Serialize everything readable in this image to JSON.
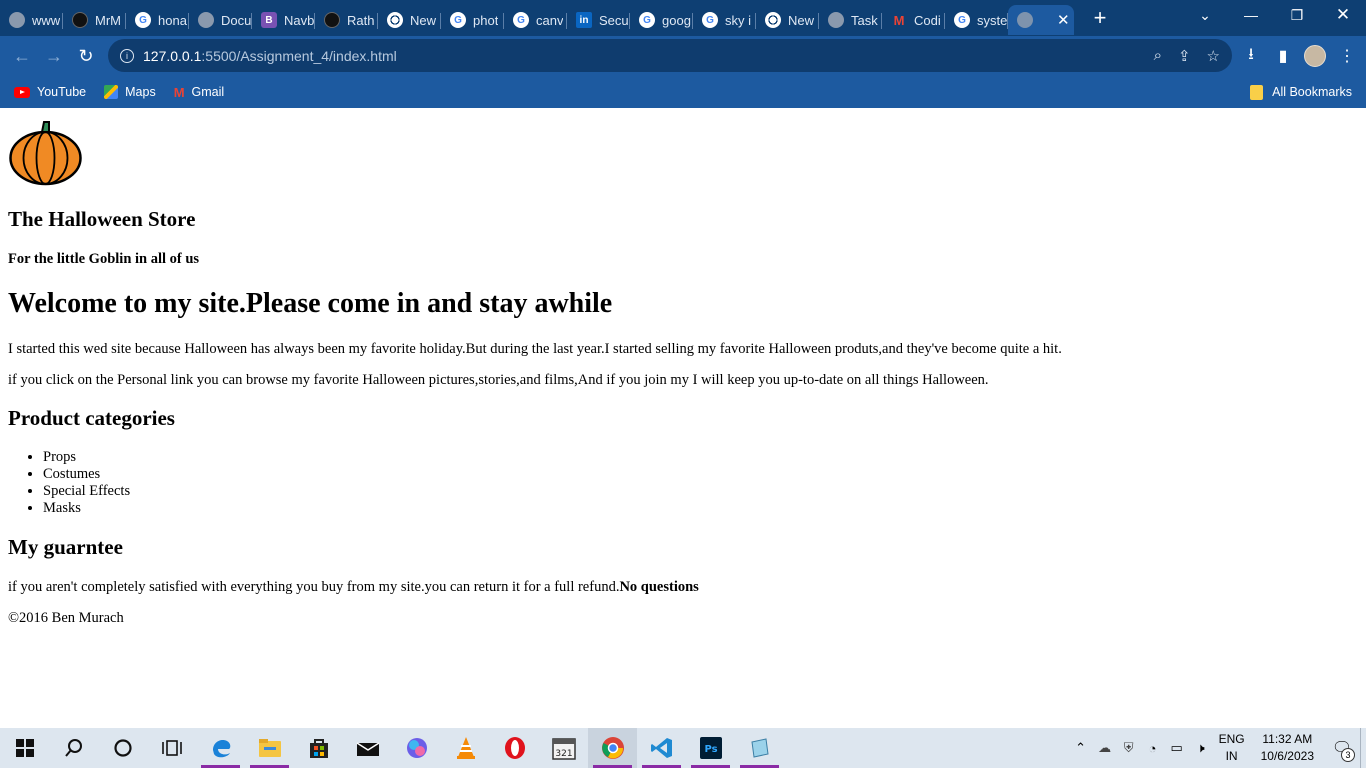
{
  "browser": {
    "tabs": [
      {
        "title": "www",
        "icon": "globe-icon",
        "color": "#8a99ad"
      },
      {
        "title": "MrM",
        "icon": "github-icon",
        "color": "#111111"
      },
      {
        "title": "hona",
        "icon": "google-icon",
        "color": "#4285f4"
      },
      {
        "title": "Docu",
        "icon": "globe-icon",
        "color": "#8a99ad"
      },
      {
        "title": "Navb",
        "icon": "bootstrap-icon",
        "color": "#7952b3"
      },
      {
        "title": "Rath",
        "icon": "github-icon",
        "color": "#111111"
      },
      {
        "title": "New",
        "icon": "chrome-icon",
        "color": "#ffffff"
      },
      {
        "title": "phot",
        "icon": "google-icon",
        "color": "#4285f4"
      },
      {
        "title": "canv",
        "icon": "google-icon",
        "color": "#4285f4"
      },
      {
        "title": "Secu",
        "icon": "linkedin-icon",
        "color": "#0a66c2"
      },
      {
        "title": "goog",
        "icon": "google-icon",
        "color": "#4285f4"
      },
      {
        "title": "sky i",
        "icon": "google-icon",
        "color": "#4285f4"
      },
      {
        "title": "New",
        "icon": "chrome-icon",
        "color": "#ffffff"
      },
      {
        "title": "Task",
        "icon": "globe-icon",
        "color": "#8a99ad"
      },
      {
        "title": "Codi",
        "icon": "gmail-icon",
        "color": "#ea4335"
      },
      {
        "title": "syste",
        "icon": "google-icon",
        "color": "#4285f4"
      }
    ],
    "active_tab_title": "",
    "url_host": "127.0.0.1",
    "url_path": ":5500/Assignment_4/index.html",
    "bookmarks": [
      {
        "label": "YouTube",
        "icon": "youtube-icon"
      },
      {
        "label": "Maps",
        "icon": "maps-icon"
      },
      {
        "label": "Gmail",
        "icon": "gmail-icon"
      }
    ],
    "all_bookmarks_label": "All Bookmarks"
  },
  "page": {
    "store_name": "The Halloween Store",
    "tagline": "For the little Goblin in all of us",
    "welcome_heading": "Welcome to my site.Please come in and stay awhile",
    "intro_paragraph": "I started this wed site because Halloween has always been my favorite holiday.But during the last year.I started selling my favorite Halloween produts,and they've become quite a hit.",
    "personal_paragraph": "if you click on the Personal link you can browse my favorite Halloween pictures,stories,and films,And if you join my I will keep you up-to-date on all things Halloween.",
    "categories_heading": "Product categories",
    "categories": [
      "Props",
      "Costumes",
      "Special Effects",
      "Masks"
    ],
    "guarantee_heading": "My guarntee",
    "guarantee_text": "if you aren't completely satisfied with everything you buy from my site.you can return it for a full refund.",
    "guarantee_bold": "No questions",
    "footer": "©2016 Ben Murach"
  },
  "taskbar": {
    "apps": [
      "start-icon",
      "search-icon",
      "cortana-icon",
      "task-view-icon",
      "edge-icon",
      "file-explorer-icon",
      "store-icon",
      "mail-icon",
      "copilot-icon",
      "vlc-icon",
      "opera-icon",
      "calendar-icon",
      "chrome-icon",
      "vscode-icon",
      "photoshop-icon",
      "notepad-icon"
    ],
    "language_top": "ENG",
    "language_bottom": "IN",
    "time": "11:32 AM",
    "date": "10/6/2023",
    "notifications_count": "3"
  }
}
